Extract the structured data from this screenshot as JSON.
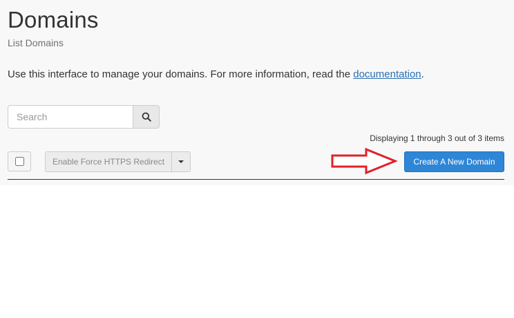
{
  "header": {
    "title": "Domains",
    "subtitle": "List Domains"
  },
  "intro": {
    "text": "Use this interface to manage your domains. For more information, read the ",
    "link_text": "documentation",
    "suffix": "."
  },
  "search": {
    "placeholder": "Search",
    "value": "",
    "button_icon": "search-icon"
  },
  "pagination": {
    "summary": "Displaying 1 through 3 out of 3 items"
  },
  "toolbar": {
    "select_all_checked": false,
    "force_https_label": "Enable Force HTTPS Redirect",
    "force_https_dropdown_icon": "chevron-down-icon",
    "create_label": "Create A New Domain"
  },
  "annotation": {
    "arrow_color": "#e0202a",
    "arrow_icon": "arrow-right-icon"
  },
  "colors": {
    "primary_button": "#2e86d7",
    "link": "#2a6fb0",
    "panel_bg": "#f8f8f8"
  }
}
